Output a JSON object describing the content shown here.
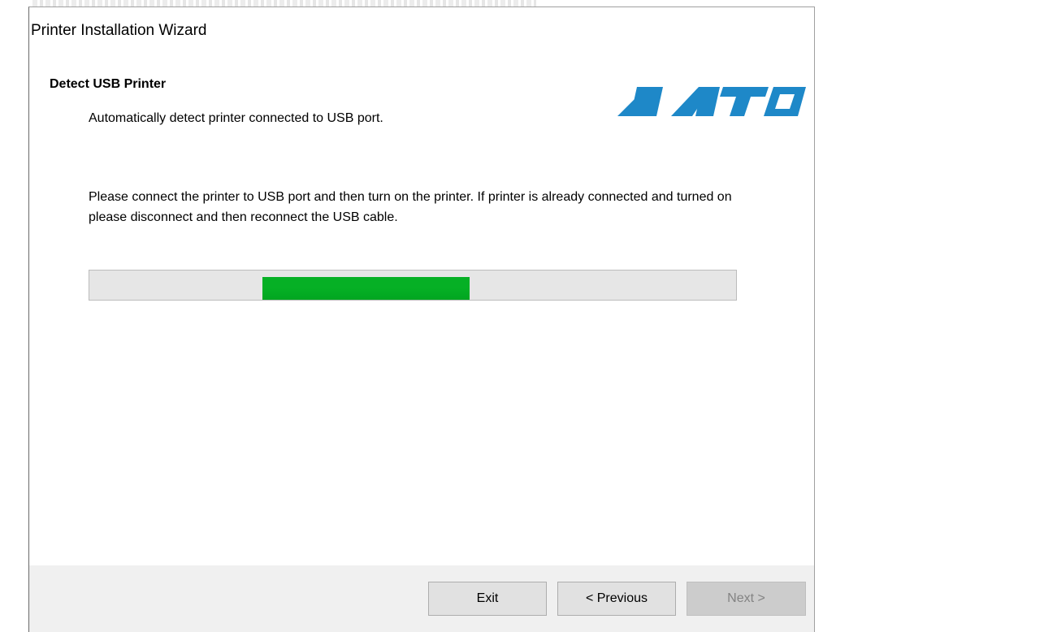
{
  "window": {
    "title": "Printer Installation Wizard"
  },
  "header": {
    "title": "Detect USB Printer",
    "subtitle": "Automatically detect printer connected to USB port.",
    "logo_text": "SATO",
    "logo_color": "#1e88c8"
  },
  "content": {
    "instructions": "Please connect the printer to USB port and then turn on the printer. If printer is already connected and turned on please disconnect and then reconnect the USB cable.",
    "progress": {
      "style": "marquee",
      "fill_color": "#06b025",
      "track_color": "#e6e6e6"
    }
  },
  "footer": {
    "exit_label": "Exit",
    "previous_label": "< Previous",
    "next_label": "Next >",
    "next_enabled": false
  }
}
